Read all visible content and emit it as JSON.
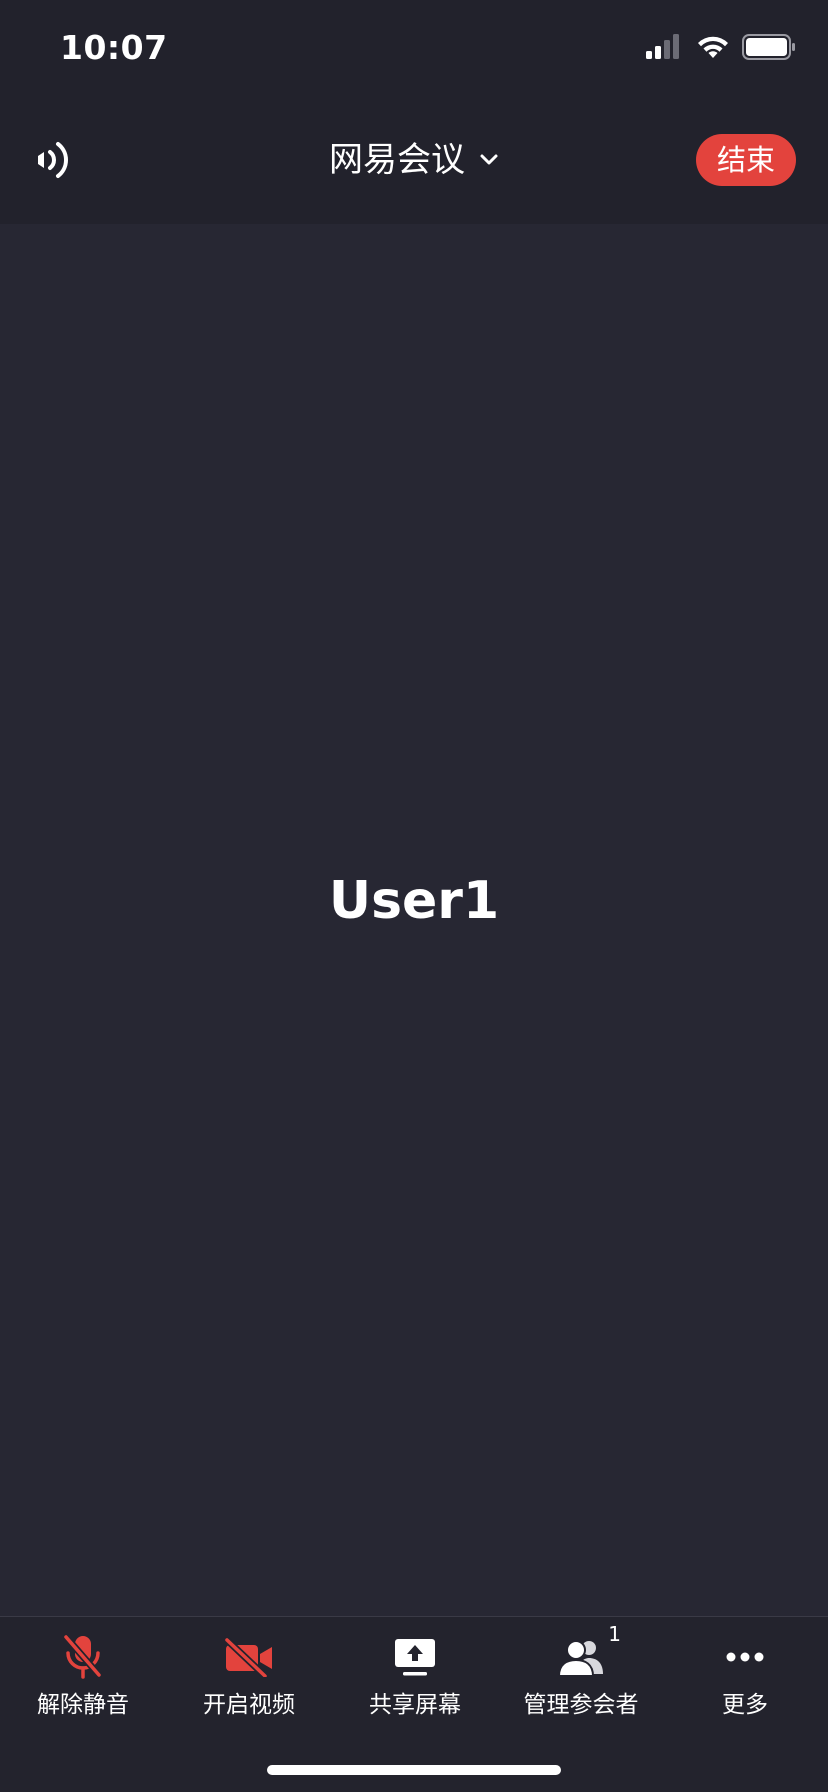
{
  "status_bar": {
    "time": "10:07"
  },
  "header": {
    "title": "网易会议",
    "end_label": "结束"
  },
  "video": {
    "participant_name": "User1"
  },
  "toolbar": {
    "items": [
      {
        "label": "解除静音",
        "icon": "mic-muted-icon"
      },
      {
        "label": "开启视频",
        "icon": "video-off-icon"
      },
      {
        "label": "共享屏幕",
        "icon": "share-screen-icon"
      },
      {
        "label": "管理参会者",
        "icon": "participants-icon",
        "count": "1"
      },
      {
        "label": "更多",
        "icon": "more-icon"
      }
    ]
  },
  "colors": {
    "accent_red": "#e3433d",
    "background": "#272733",
    "header": "#22222c"
  }
}
